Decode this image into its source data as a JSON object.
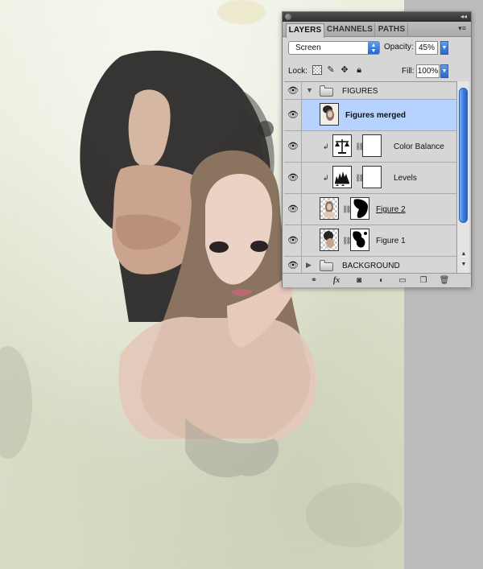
{
  "panel": {
    "tabs": [
      {
        "label": "LAYERS",
        "active": true
      },
      {
        "label": "CHANNELS",
        "active": false
      },
      {
        "label": "PATHS",
        "active": false
      }
    ],
    "collapse_glyph": "◂◂",
    "menu_glyph": "▾≡",
    "blend_mode": "Screen",
    "opacity_label": "Opacity:",
    "opacity_value": "45%",
    "lock_label": "Lock:",
    "fill_label": "Fill:",
    "fill_value": "100%",
    "layers": [
      {
        "name": "FIGURES",
        "type": "group",
        "expanded": true,
        "visible": true
      },
      {
        "name": "Figures merged",
        "type": "layer",
        "selected": true,
        "visible": true
      },
      {
        "name": "Color Balance",
        "type": "adjustment",
        "icon": "scales-icon",
        "clipped": true,
        "visible": true
      },
      {
        "name": "Levels",
        "type": "adjustment",
        "icon": "histogram-icon",
        "clipped": true,
        "visible": true
      },
      {
        "name": "Figure 2",
        "type": "layer",
        "has_mask": true,
        "visible": true
      },
      {
        "name": "Figure 1",
        "type": "layer",
        "has_mask": true,
        "visible": true
      },
      {
        "name": "BACKGROUND",
        "type": "group",
        "expanded": false,
        "visible": true
      }
    ],
    "footer_icons": [
      "link-icon",
      "fx-icon",
      "add-mask-icon",
      "adjustment-layer-icon",
      "new-group-icon",
      "new-layer-icon",
      "trash-icon"
    ],
    "colors": {
      "selection": "#b6d3ff",
      "accent": "#3c7fe0"
    }
  }
}
